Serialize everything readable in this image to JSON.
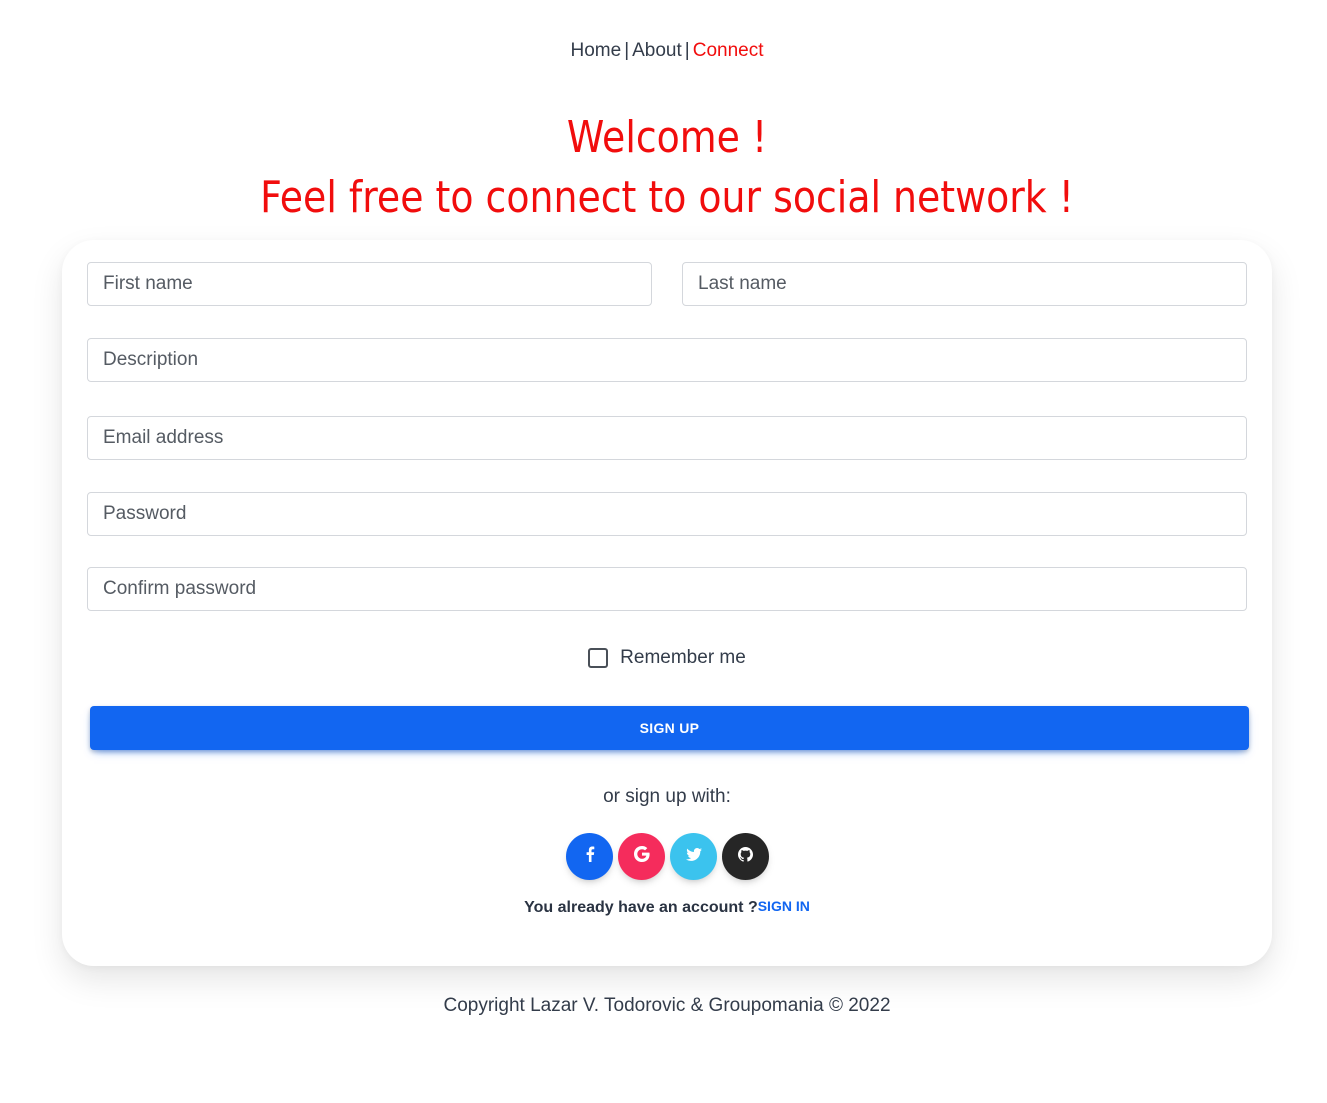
{
  "nav": {
    "home": "Home",
    "about": "About",
    "connect": "Connect",
    "separator": "|"
  },
  "hero": {
    "line1": "Welcome !",
    "line2": "Feel free to connect to our social network !"
  },
  "form": {
    "first_name_placeholder": "First name",
    "last_name_placeholder": "Last name",
    "description_placeholder": "Description",
    "email_placeholder": "Email address",
    "password_placeholder": "Password",
    "confirm_password_placeholder": "Confirm password",
    "remember_label": "Remember me",
    "remember_checked": false,
    "signup_label": "SIGN UP",
    "or_text": "or sign up with:",
    "account_text": "You already have an account ?",
    "signin_label": "SIGN IN"
  },
  "socials": [
    {
      "name": "facebook-icon",
      "glyph": "f",
      "color": "#1266f1"
    },
    {
      "name": "google-icon",
      "glyph": "G",
      "color": "#f52c5c"
    },
    {
      "name": "twitter-icon",
      "glyph": "twitter-bird",
      "color": "#3bc3ee"
    },
    {
      "name": "github-icon",
      "glyph": "github-cat",
      "color": "#262626"
    }
  ],
  "colors": {
    "accent_red": "#f10d0d",
    "primary_blue": "#1266f1"
  },
  "footer": {
    "text": "Copyright Lazar V. Todorovic & Groupomania © 2022"
  }
}
